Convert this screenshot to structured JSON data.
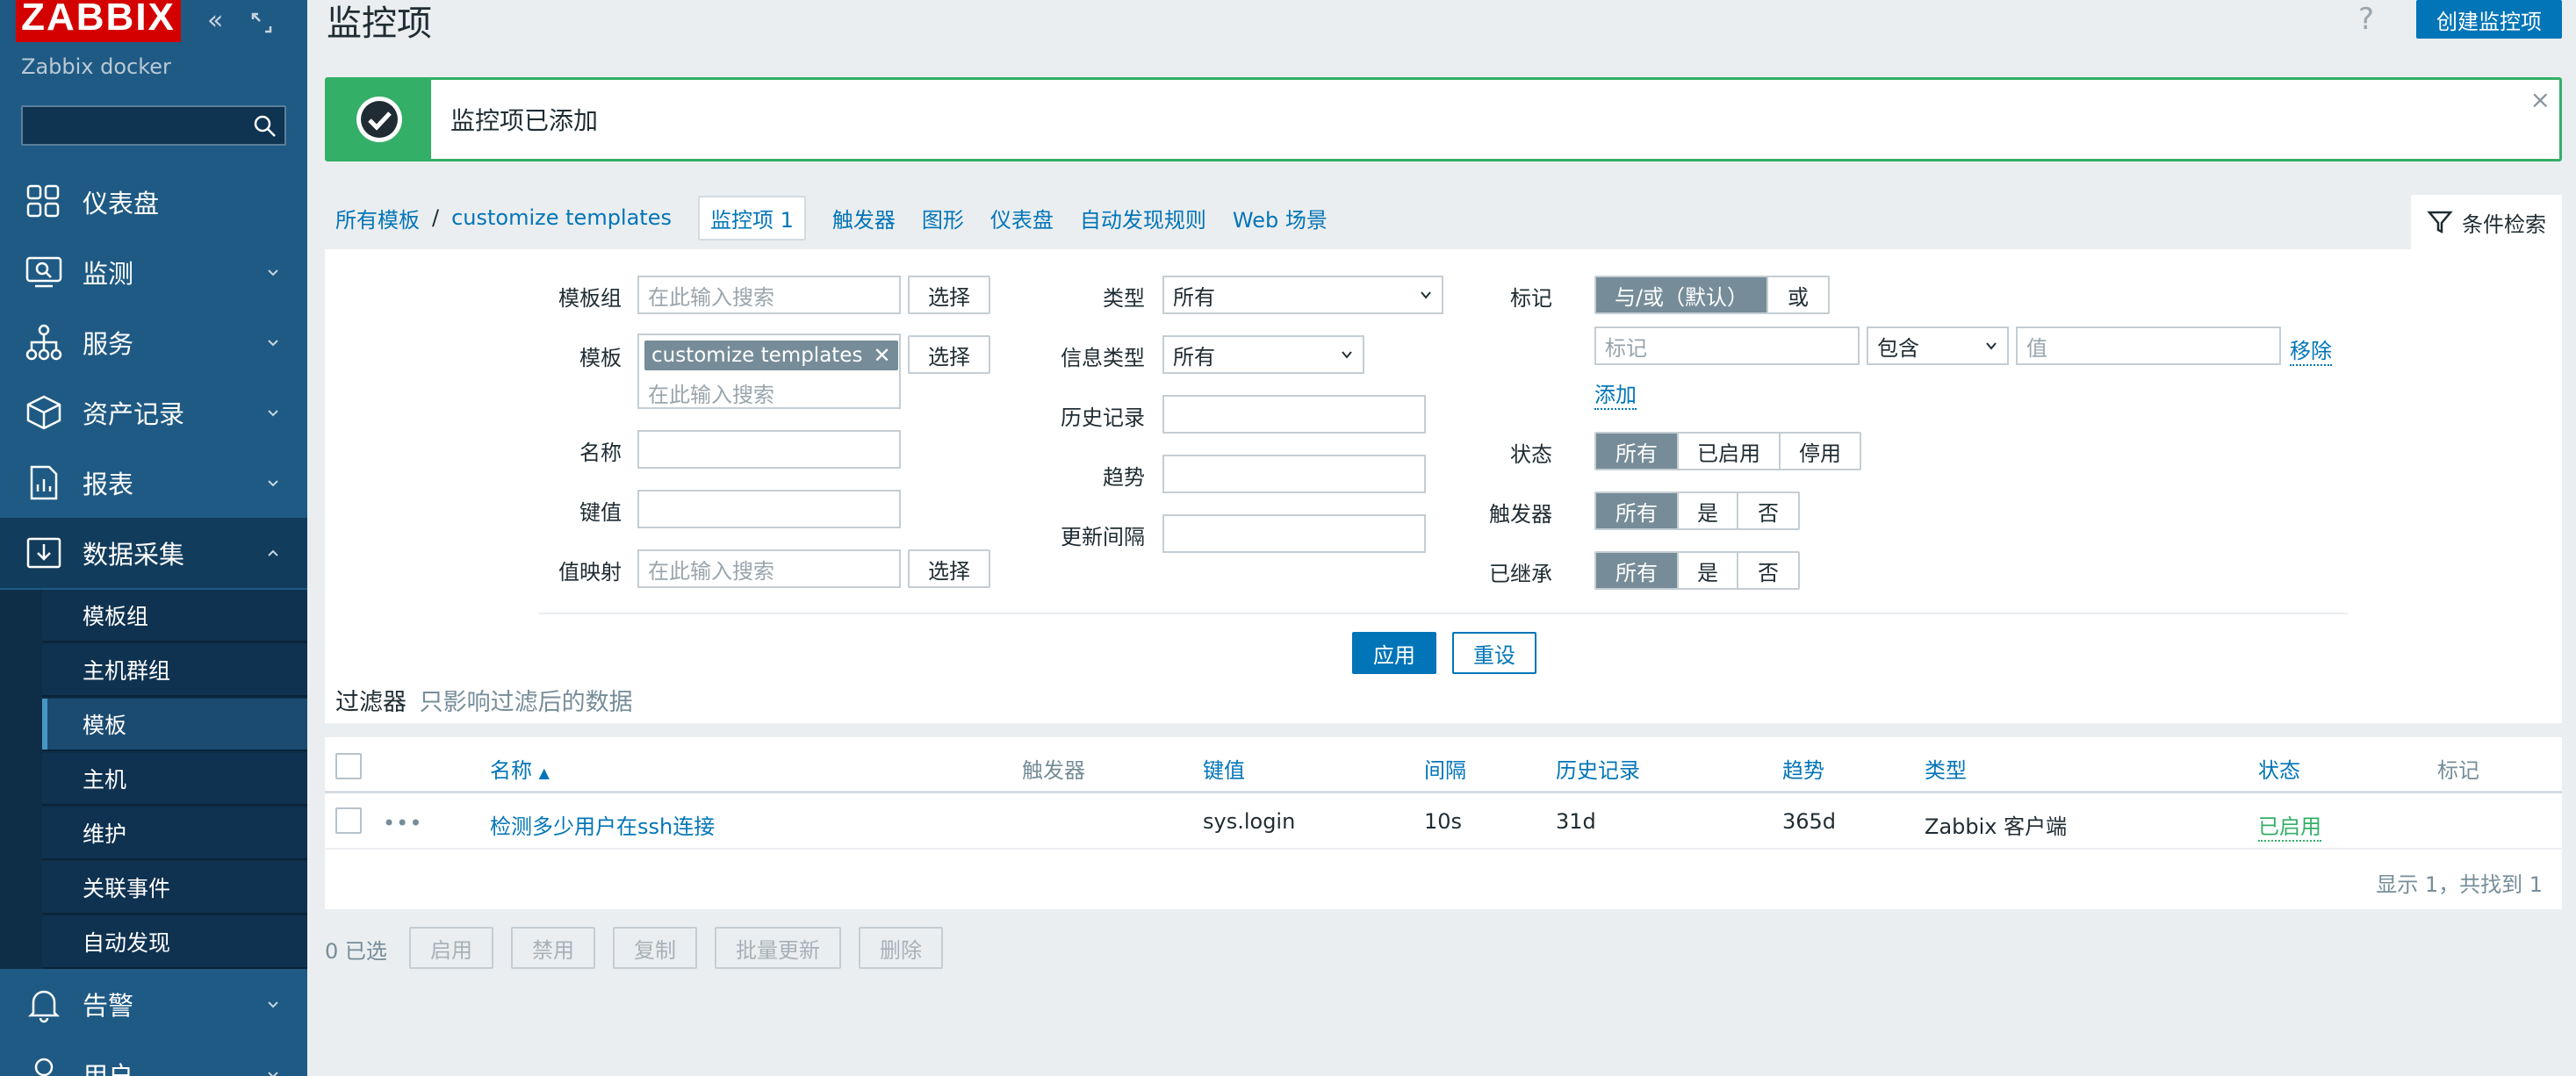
{
  "sidebar": {
    "logo": "ZABBIX",
    "server_name": "Zabbix docker",
    "search_placeholder": "",
    "items": [
      {
        "label": "仪表盘",
        "icon": "dashboard-icon"
      },
      {
        "label": "监测",
        "icon": "monitoring-icon"
      },
      {
        "label": "服务",
        "icon": "services-icon"
      },
      {
        "label": "资产记录",
        "icon": "inventory-icon"
      },
      {
        "label": "报表",
        "icon": "reports-icon"
      },
      {
        "label": "数据采集",
        "icon": "data-collection-icon"
      },
      {
        "label": "告警",
        "icon": "alerts-icon"
      },
      {
        "label": "用户",
        "icon": "users-icon"
      }
    ],
    "submenu": [
      "模板组",
      "主机群组",
      "模板",
      "主机",
      "维护",
      "关联事件",
      "自动发现"
    ],
    "active_submenu": "模板"
  },
  "header": {
    "title": "监控项",
    "help": "?",
    "create_button": "创建监控项"
  },
  "message": {
    "text": "监控项已添加",
    "close": "×"
  },
  "breadcrumb": {
    "all_templates": "所有模板",
    "separator": "/",
    "template": "customize templates",
    "tabs": [
      "监控项 1",
      "触发器",
      "图形",
      "仪表盘",
      "自动发现规则",
      "Web 场景"
    ]
  },
  "filter": {
    "tab_label": "条件检索",
    "labels": {
      "template_group": "模板组",
      "template": "模板",
      "name": "名称",
      "key": "键值",
      "value_map": "值映射",
      "type": "类型",
      "info_type": "信息类型",
      "history": "历史记录",
      "trends": "趋势",
      "update_interval": "更新间隔",
      "tags": "标记",
      "status": "状态",
      "triggers": "触发器",
      "inherited": "已继承"
    },
    "search_placeholder": "在此输入搜索",
    "select_button": "选择",
    "template_chip": "customize templates",
    "type_value": "所有",
    "info_type_value": "所有",
    "tags_mode": [
      "与/或（默认）",
      "或"
    ],
    "tag_placeholder": "标记",
    "tag_operator": "包含",
    "tag_value_placeholder": "值",
    "remove_link": "移除",
    "add_link": "添加",
    "status_options": [
      "所有",
      "已启用",
      "停用"
    ],
    "triggers_options": [
      "所有",
      "是",
      "否"
    ],
    "inherited_options": [
      "所有",
      "是",
      "否"
    ],
    "apply": "应用",
    "reset": "重设",
    "note_title": "过滤器",
    "note_sub": "只影响过滤后的数据"
  },
  "table": {
    "columns": {
      "name": "名称",
      "triggers": "触发器",
      "key": "键值",
      "interval": "间隔",
      "history": "历史记录",
      "trends": "趋势",
      "type": "类型",
      "status": "状态",
      "tags": "标记"
    },
    "rows": [
      {
        "menu": "•••",
        "name": "检测多少用户在ssh连接",
        "triggers": "",
        "key": "sys.login",
        "interval": "10s",
        "history": "31d",
        "trends": "365d",
        "type": "Zabbix 客户端",
        "status": "已启用",
        "tags": ""
      }
    ],
    "footer": "显示 1，共找到 1"
  },
  "actions": {
    "selected": "0 已选",
    "buttons": [
      "启用",
      "禁用",
      "复制",
      "批量更新",
      "删除"
    ]
  }
}
